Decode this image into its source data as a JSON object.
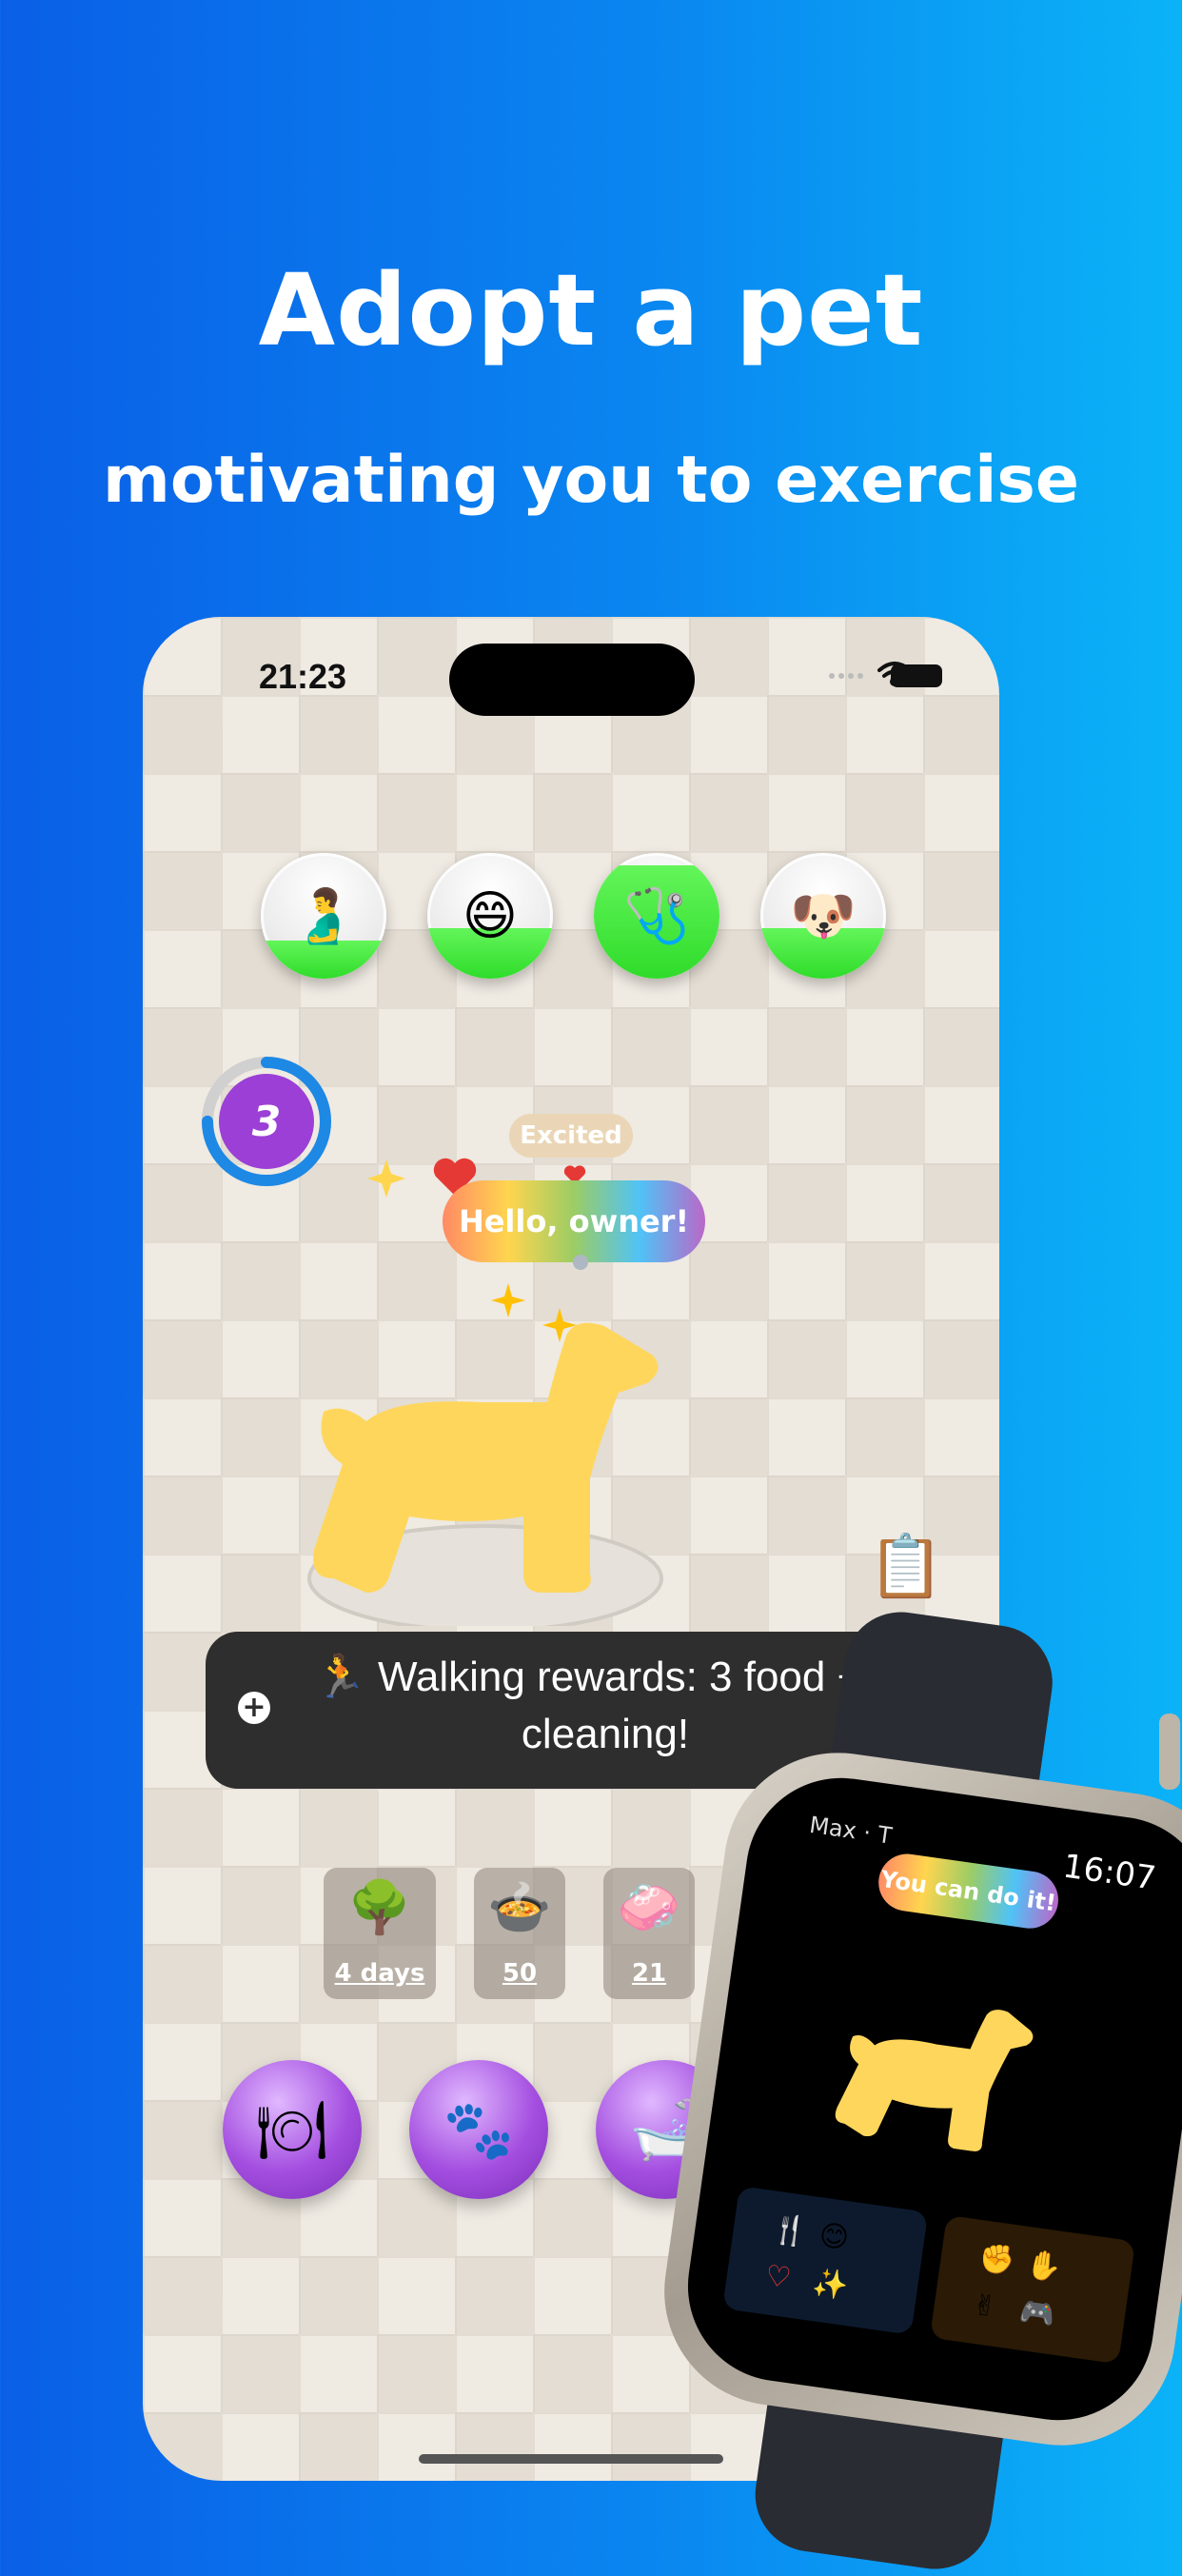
{
  "hero": {
    "headline": "Adopt a pet",
    "subheadline": "motivating you to exercise"
  },
  "status_bar": {
    "time": "21:23"
  },
  "stats": [
    {
      "name": "hunger",
      "icon": "stomach-icon",
      "glyph": "🫃",
      "level": 0.3
    },
    {
      "name": "happiness",
      "icon": "smile-icon",
      "glyph": "😄",
      "level": 0.4
    },
    {
      "name": "health",
      "icon": "stethoscope-icon",
      "glyph": "🩺",
      "level": 0.9
    },
    {
      "name": "cleanliness",
      "icon": "clean-dog-icon",
      "glyph": "🐶",
      "level": 0.4
    }
  ],
  "level": {
    "value": "3",
    "progress": 0.75
  },
  "pet": {
    "mood": "Excited",
    "speech": "Hello, owner!"
  },
  "toast": {
    "emoji": "🏃",
    "message": "Walking rewards: 3 food + 1 cleaning!"
  },
  "resources": [
    {
      "icon": "tree-icon",
      "glyph": "🌳",
      "value": "4 days"
    },
    {
      "icon": "food-bowl-icon",
      "glyph": "🍲",
      "value": "50"
    },
    {
      "icon": "soap-icon",
      "glyph": "🧼",
      "value": "21"
    }
  ],
  "actions": [
    {
      "icon": "feed-icon",
      "glyph": "🍽"
    },
    {
      "icon": "pet-icon",
      "glyph": "🐾"
    },
    {
      "icon": "bath-icon",
      "glyph": "🛁"
    }
  ],
  "watch": {
    "owner": "Max · T",
    "time": "16:07",
    "pill": "You can do it!",
    "card1_glyphs": [
      "🍴",
      "😊",
      "♡",
      "✨"
    ],
    "card2_glyphs": [
      "✊",
      "✋",
      "✌",
      "🎮"
    ]
  },
  "colors": {
    "background_left": "#0a5fe6",
    "background_right": "#0bb3f7",
    "pet_yellow": "#ffd65c",
    "stat_green": "#3fe636",
    "action_purple": "#a44ee0",
    "level_ring": "#1e88e5"
  }
}
